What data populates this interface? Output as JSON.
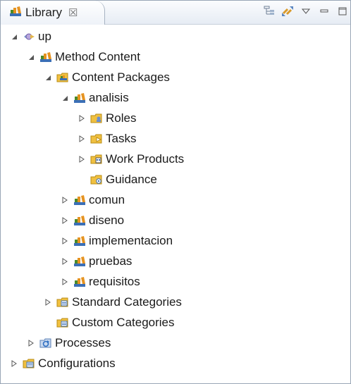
{
  "view": {
    "tab_title": "Library",
    "tab_close": "☒",
    "toolbar": [
      {
        "icon": "collapse-all-icon"
      },
      {
        "icon": "link-with-editor-icon"
      },
      {
        "icon": "view-menu-icon"
      },
      {
        "icon": "minimize-icon"
      },
      {
        "icon": "maximize-icon"
      }
    ]
  },
  "tree": [
    {
      "label": "up",
      "level": 0,
      "state": "expanded",
      "icon": "plugin-icon"
    },
    {
      "label": "Method Content",
      "level": 1,
      "state": "expanded",
      "icon": "method-content-icon"
    },
    {
      "label": "Content Packages",
      "level": 2,
      "state": "expanded",
      "icon": "content-packages-icon"
    },
    {
      "label": "analisis",
      "level": 3,
      "state": "expanded",
      "icon": "package-icon"
    },
    {
      "label": "Roles",
      "level": 4,
      "state": "collapsed",
      "icon": "roles-folder-icon"
    },
    {
      "label": "Tasks",
      "level": 4,
      "state": "collapsed",
      "icon": "tasks-folder-icon"
    },
    {
      "label": "Work Products",
      "level": 4,
      "state": "collapsed",
      "icon": "work-products-folder-icon"
    },
    {
      "label": "Guidance",
      "level": 4,
      "state": "leaf",
      "icon": "guidance-folder-icon"
    },
    {
      "label": "comun",
      "level": 3,
      "state": "collapsed",
      "icon": "package-icon"
    },
    {
      "label": "diseno",
      "level": 3,
      "state": "collapsed",
      "icon": "package-icon"
    },
    {
      "label": "implementacion",
      "level": 3,
      "state": "collapsed",
      "icon": "package-icon"
    },
    {
      "label": "pruebas",
      "level": 3,
      "state": "collapsed",
      "icon": "package-icon"
    },
    {
      "label": "requisitos",
      "level": 3,
      "state": "collapsed",
      "icon": "package-icon"
    },
    {
      "label": "Standard Categories",
      "level": 2,
      "state": "collapsed",
      "icon": "standard-categories-icon"
    },
    {
      "label": "Custom Categories",
      "level": 2,
      "state": "leaf",
      "icon": "custom-categories-icon"
    },
    {
      "label": "Processes",
      "level": 1,
      "state": "collapsed",
      "icon": "processes-icon"
    },
    {
      "label": "Configurations",
      "level": 0,
      "state": "collapsed",
      "icon": "configurations-icon"
    }
  ],
  "colors": {
    "package_orange": "#e69320",
    "package_green": "#4a8a2a",
    "package_blue": "#3b6fb6",
    "folder": "#f0c040",
    "twisty": "#555555"
  }
}
